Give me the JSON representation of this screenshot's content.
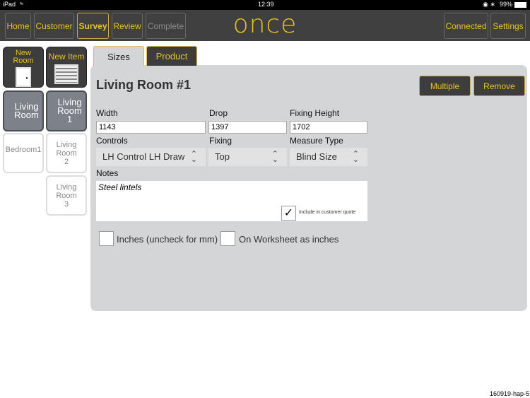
{
  "status": {
    "device": "iPad",
    "time": "12:39",
    "battery": "99%"
  },
  "nav": {
    "home": "Home",
    "customer": "Customer",
    "survey": "Survey",
    "review": "Review",
    "complete": "Complete",
    "connected": "Connected",
    "settings": "Settings",
    "logo": "once"
  },
  "left": {
    "new_room": "New Room",
    "new_item": "New Item",
    "rooms": [
      "Living Room",
      "Bedroom1"
    ],
    "items": [
      [
        "Living",
        "Room",
        "1"
      ],
      [
        "Living",
        "Room",
        "2"
      ],
      [
        "Living",
        "Room",
        "3"
      ]
    ]
  },
  "tabs": {
    "sizes": "Sizes",
    "product": "Product"
  },
  "main": {
    "title": "Living Room #1",
    "multiple": "Multiple",
    "remove": "Remove",
    "width_label": "Width",
    "width": "1143",
    "drop_label": "Drop",
    "drop": "1397",
    "fixing_height_label": "Fixing Height",
    "fixing_height": "1702",
    "controls_label": "Controls",
    "controls": "LH Control LH Draw",
    "fixing_label": "Fixing",
    "fixing": "Top",
    "measure_label": "Measure Type",
    "measure": "Blind Size",
    "notes_label": "Notes",
    "notes": "Steel lintels",
    "include_quote": "Include in customer quote",
    "inches": "Inches (uncheck for mm)",
    "worksheet_inches": "On Worksheet as inches"
  },
  "footer": "160919-hap-5",
  "colors": {
    "accent": "#e8c21f",
    "nav": "#404040",
    "panel": "#d4d5d7"
  }
}
